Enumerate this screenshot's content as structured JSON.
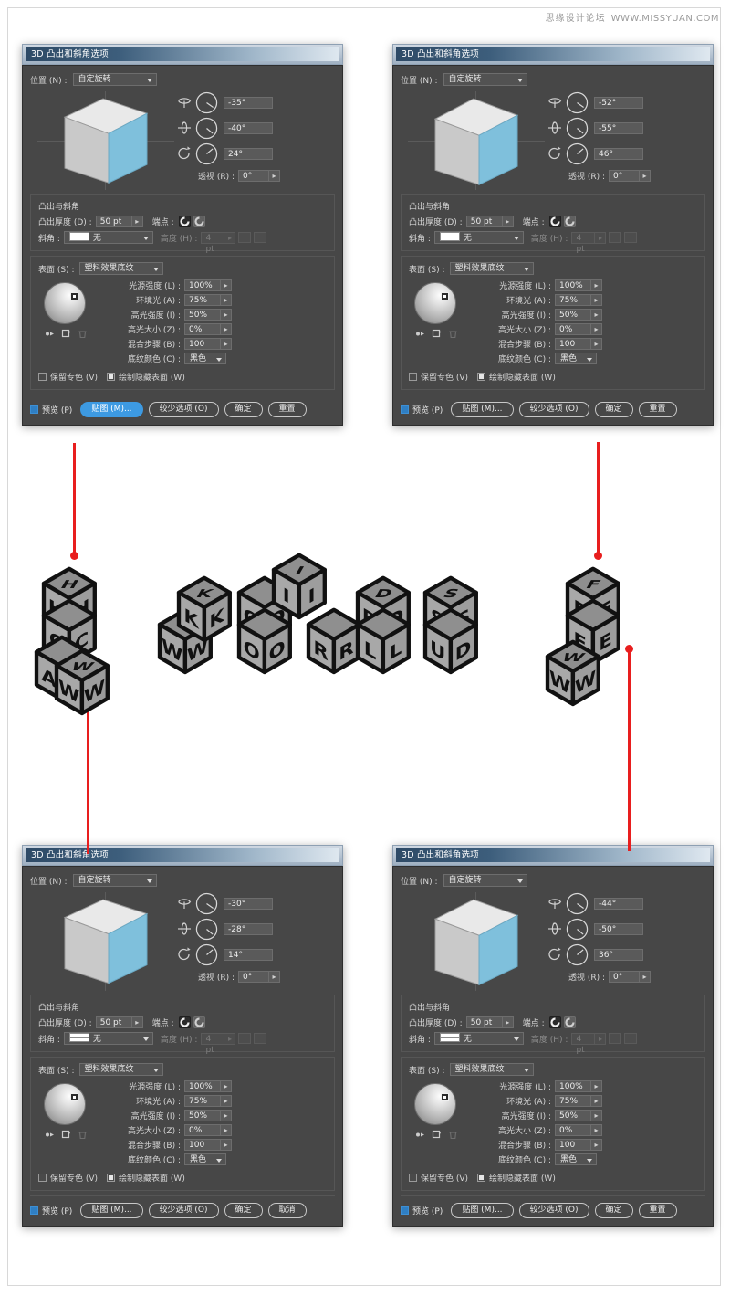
{
  "watermark": {
    "cn": "思缘设计论坛",
    "url": "WWW.MISSYUAN.COM"
  },
  "dialog_common": {
    "title": "3D 凸出和斜角选项",
    "position_label": "位置 (N) :",
    "position_value": "自定旋转",
    "perspective_label": "透视 (R) :",
    "perspective_value": "0°",
    "extrude_section_title": "凸出与斜角",
    "extrude_depth_label": "凸出厚度 (D) :",
    "extrude_depth_value": "50 pt",
    "cap_label": "端点 :",
    "bevel_label": "斜角 :",
    "bevel_value": "无",
    "height_label": "高度 (H) :",
    "height_value": "4 pt",
    "surface_label": "表面 (S) :",
    "surface_value": "塑料效果底纹",
    "light_intensity_label": "光源强度 (L) :",
    "light_intensity_value": "100%",
    "ambient_label": "环境光 (A) :",
    "ambient_value": "75%",
    "highlight_intensity_label": "高光强度 (I) :",
    "highlight_intensity_value": "50%",
    "highlight_size_label": "高光大小 (Z) :",
    "highlight_size_value": "0%",
    "blend_steps_label": "混合步骤 (B) :",
    "blend_steps_value": "100",
    "shading_color_label": "底纹颜色 (C) :",
    "shading_color_value": "黑色",
    "preserve_spot_label": "保留专色 (V)",
    "draw_hidden_label": "绘制隐藏表面 (W)",
    "preview_label": "预览 (P)",
    "map_button": "贴图 (M)...",
    "fewer_options_button": "较少选项 (O)",
    "ok_button": "确定",
    "reset_button": "重置",
    "cancel_button": "取消"
  },
  "dialogs": [
    {
      "id": "dialog-top-left",
      "rotate_x": "-35°",
      "rotate_y": "-40°",
      "rotate_z": "24°",
      "last_button": "重置",
      "highlight": "map"
    },
    {
      "id": "dialog-top-right",
      "rotate_x": "-52°",
      "rotate_y": "-55°",
      "rotate_z": "46°",
      "last_button": "重置",
      "highlight": "none"
    },
    {
      "id": "dialog-bottom-left",
      "rotate_x": "-30°",
      "rotate_y": "-28°",
      "rotate_z": "14°",
      "last_button": "取消",
      "highlight": "none"
    },
    {
      "id": "dialog-bottom-right",
      "rotate_x": "-44°",
      "rotate_y": "-50°",
      "rotate_z": "36°",
      "last_button": "重置",
      "highlight": "none"
    }
  ],
  "blocks": {
    "left_stack": [
      "H",
      "H",
      "H",
      "C",
      "C",
      "A",
      "W",
      "W"
    ],
    "middle_group": [
      "K",
      "K",
      "K",
      "I",
      "I",
      "I",
      "W",
      "W",
      "O",
      "O",
      "R",
      "R",
      "D",
      "D",
      "S",
      "S",
      "L",
      "L",
      "U",
      "D"
    ],
    "right_stack": [
      "F",
      "F",
      "F",
      "E",
      "E",
      "W",
      "W"
    ]
  },
  "colors": {
    "dialog_bg": "#474747",
    "accent_blue": "#3d9ae2",
    "cube_face_blue": "#7fc0dc",
    "arrow_red": "#e81e1e",
    "block_face": "#9a9a9a",
    "block_outline": "#111111"
  }
}
